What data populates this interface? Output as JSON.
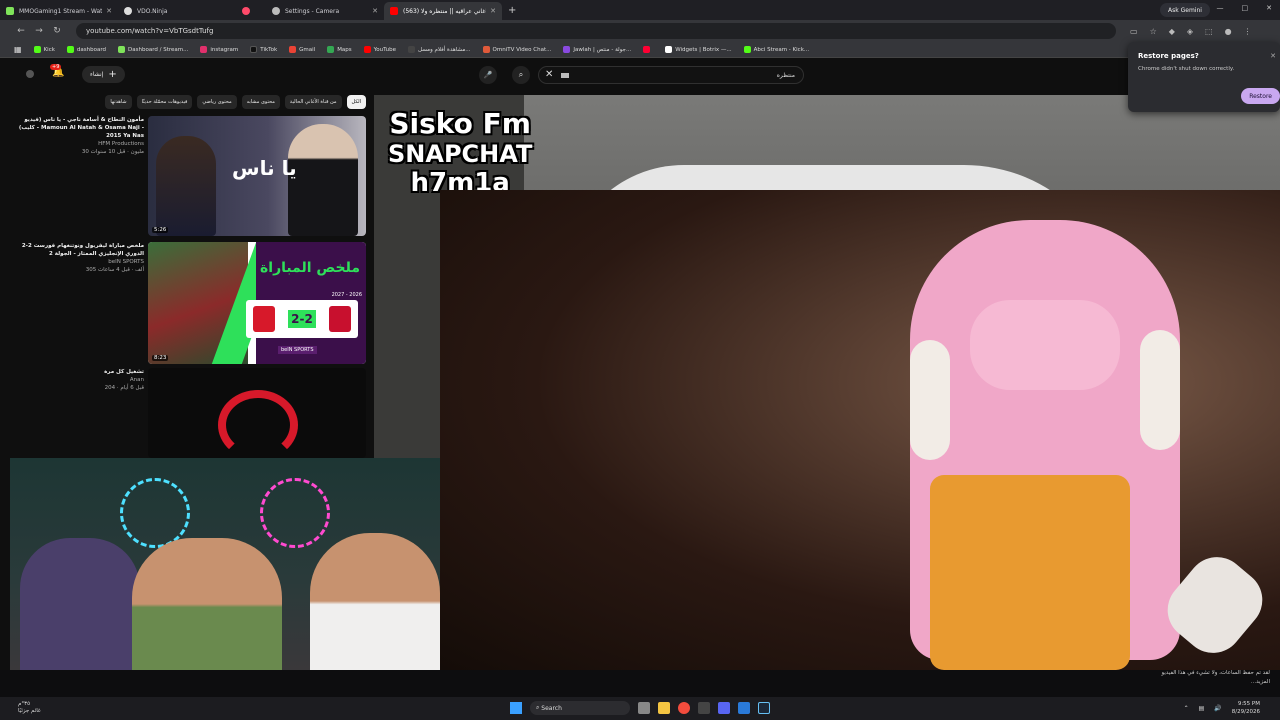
{
  "tabs": [
    {
      "title": "MMOGaming1 Stream - Watc",
      "color": "#7fe35a"
    },
    {
      "title": "VDO.Ninja",
      "color": "#dddddd"
    },
    {
      "title": "",
      "color": "#ff4a6a"
    },
    {
      "title": "Settings - Camera",
      "color": "#bbbbbb"
    },
    {
      "title": "(563) اغاني عراقيه || منتظره ولا",
      "color": "#ff0000"
    }
  ],
  "newtab": "+",
  "gemini": "Ask Gemini",
  "window_controls": [
    "—",
    "□",
    "✕"
  ],
  "url": "youtube.com/watch?v=VbTGsdtTufg",
  "bookmarks": [
    {
      "label": "Kick",
      "color": "#53fc18"
    },
    {
      "label": "dashboard",
      "color": "#53fc18"
    },
    {
      "label": "Dashboard / Stream...",
      "color": "#7fe35a"
    },
    {
      "label": "instagram",
      "color": "#e1306c"
    },
    {
      "label": "TikTok",
      "color": "#111111"
    },
    {
      "label": "Gmail",
      "color": "#ea4335"
    },
    {
      "label": "Maps",
      "color": "#34a853"
    },
    {
      "label": "YouTube",
      "color": "#ff0000"
    },
    {
      "label": "مشاهدة أفلام ومسل...",
      "color": "#444444"
    },
    {
      "label": "OmniTV Video Chat...",
      "color": "#e05a3a"
    },
    {
      "label": "Jawlah | جولة - منتص...",
      "color": "#8a4ae0"
    },
    {
      "label": "",
      "color": "#ff0033"
    },
    {
      "label": "Widgets | Botrix —...",
      "color": "#ffffff"
    },
    {
      "label": "Abci Stream - Kick...",
      "color": "#53fc18"
    }
  ],
  "yt": {
    "create_label": "إنشاء",
    "notif_count": "+9",
    "search_value": "منتظره",
    "chips": [
      {
        "label": "الكل",
        "active": true
      },
      {
        "label": "من قناة الأغاني الحالية",
        "active": false
      },
      {
        "label": "محتوى مشابه",
        "active": false
      },
      {
        "label": "محتوى رياضي",
        "active": false
      },
      {
        "label": "فيديوهات محمّلة حديثًا",
        "active": false
      },
      {
        "label": "شاهدتها",
        "active": false
      }
    ],
    "recs": [
      {
        "title": "مأمون النطاح & أسامة ناجي - يا ناس (فيديو كليب) - Mamoun Al Natah & Osama Naji - 2015 Ya Nas",
        "channel": "HFM Productions",
        "stats": "30 مليون · قبل 10 سنوات",
        "duration": "5:26",
        "thumb_text": "يا ناس"
      },
      {
        "title": "ملخص مباراة ليفربول ونوتنغهام فورست 2-2 الدوري الإنجليزي الممتاز - الجولة 2",
        "channel": "beIN SPORTS",
        "stats": "305 ألف · قبل 4 ساعات",
        "duration": "8:23",
        "thumb_text": "ملخص المباراة",
        "score": "2-2",
        "brand": "beIN SPORTS",
        "season": "2027 - 2026"
      },
      {
        "title": "تشغيل كل مرة",
        "channel": "Anan",
        "stats": "204 · قبل 6 أيام",
        "duration": "",
        "thumb_text": ""
      }
    ],
    "video_overlay": [
      "Sisko Fm",
      "SNAPCHAT",
      "h7m1a"
    ]
  },
  "restore": {
    "title": "Restore pages?",
    "body": "Chrome didn't shut down correctly.",
    "button": "Restore"
  },
  "stream_caption": [
    "لقد تم حفظ الساعات، ولا تشيء في هذا الفيديو",
    "...المزيد"
  ],
  "taskbar": {
    "search": "Search",
    "weather": [
      "٣٥°م",
      "غائم جزئيًا"
    ],
    "time": "9:55 PM",
    "date": "8/29/2026"
  }
}
